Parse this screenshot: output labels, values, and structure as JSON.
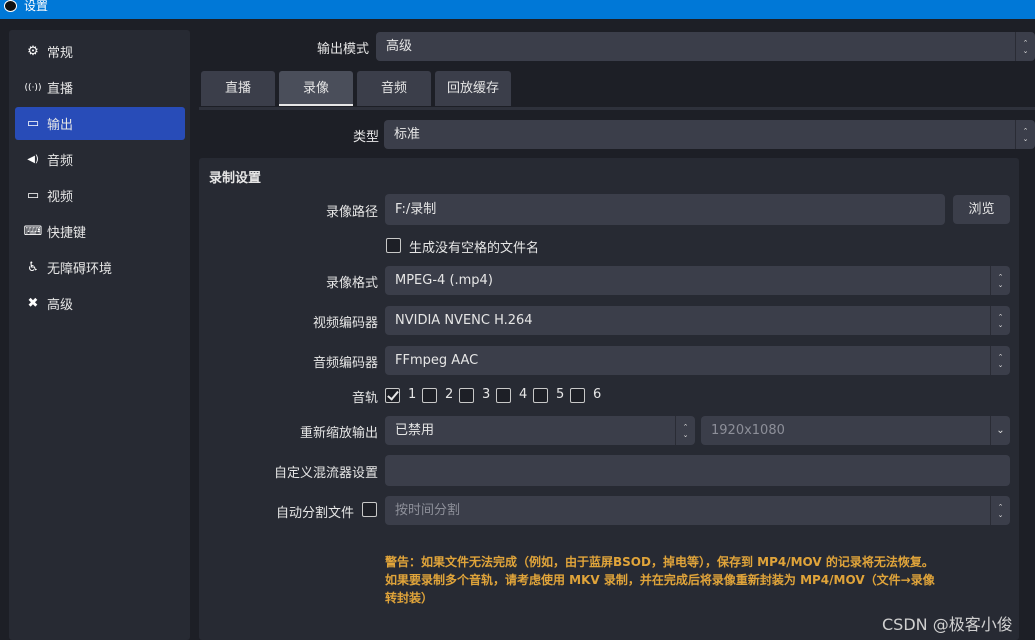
{
  "window": {
    "title": "设置"
  },
  "sidebar": {
    "items": [
      {
        "label": "常规",
        "icon": "gear-icon",
        "glyph": "⚙"
      },
      {
        "label": "直播",
        "icon": "broadcast-icon",
        "glyph": "((·))"
      },
      {
        "label": "输出",
        "icon": "output-icon",
        "glyph": "▭"
      },
      {
        "label": "音频",
        "icon": "speaker-icon",
        "glyph": "◀)"
      },
      {
        "label": "视频",
        "icon": "monitor-icon",
        "glyph": "▭"
      },
      {
        "label": "快捷键",
        "icon": "keyboard-icon",
        "glyph": "⌨"
      },
      {
        "label": "无障碍环境",
        "icon": "accessibility-icon",
        "glyph": "♿"
      },
      {
        "label": "高级",
        "icon": "tools-icon",
        "glyph": "✖"
      }
    ],
    "active": 2
  },
  "output_mode": {
    "label": "输出模式",
    "value": "高级"
  },
  "tabs": [
    "直播",
    "录像",
    "音频",
    "回放缓存"
  ],
  "active_tab": 1,
  "type": {
    "label": "类型",
    "value": "标准"
  },
  "recording": {
    "section_title": "录制设置",
    "path_label": "录像路径",
    "path_value": "F:/录制",
    "browse_label": "浏览",
    "nospace_label": "生成没有空格的文件名",
    "format_label": "录像格式",
    "format_value": "MPEG-4 (.mp4)",
    "video_encoder_label": "视频编码器",
    "video_encoder_value": "NVIDIA NVENC H.264",
    "audio_encoder_label": "音频编码器",
    "audio_encoder_value": "FFmpeg AAC",
    "tracks_label": "音轨",
    "tracks": [
      {
        "label": "1",
        "checked": true
      },
      {
        "label": "2",
        "checked": false
      },
      {
        "label": "3",
        "checked": false
      },
      {
        "label": "4",
        "checked": false
      },
      {
        "label": "5",
        "checked": false
      },
      {
        "label": "6",
        "checked": false
      }
    ],
    "rescale_label": "重新缩放输出",
    "rescale_value": "已禁用",
    "rescale_resolution": "1920x1080",
    "muxer_label": "自定义混流器设置",
    "muxer_value": "",
    "autosplit_label": "自动分割文件",
    "autosplit_value": "按时间分割",
    "warning_line1": "警告：如果文件无法完成（例如，由于蓝屏BSOD，掉电等），保存到 MP4/MOV 的记录将无法恢复。",
    "warning_line2": "如果要录制多个音轨，请考虑使用 MKV 录制，并在完成后将录像重新封装为 MP4/MOV（文件→录像",
    "warning_line3": "转封装）"
  },
  "watermark": "CSDN @极客小俊",
  "colors": {
    "accent": "#284cb8",
    "titlebar": "#0078d7",
    "warning": "#e0a43a"
  }
}
